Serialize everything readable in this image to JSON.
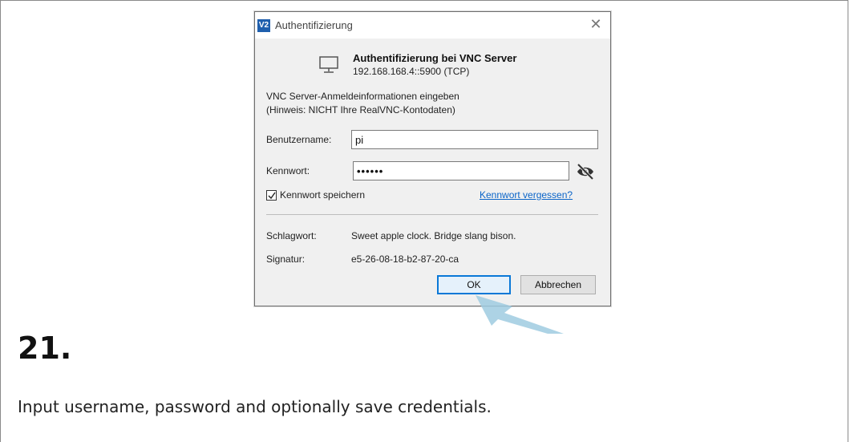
{
  "dialog": {
    "app_logo_text": "V2",
    "title": "Authentifizierung",
    "header_title": "Authentifizierung bei VNC Server",
    "header_subtitle": "192.168.168.4::5900 (TCP)",
    "hint_line1": "VNC Server-Anmeldeinformationen eingeben",
    "hint_line2": "(Hinweis: NICHT Ihre RealVNC-Kontodaten)",
    "username_label": "Benutzername:",
    "username_value": "pi",
    "password_label": "Kennwort:",
    "password_value": "••••••",
    "remember_label": "Kennwort speichern",
    "remember_checked": true,
    "forgot_link": "Kennwort vergessen?",
    "catchphrase_label": "Schlagwort:",
    "catchphrase_value": "Sweet apple clock. Bridge slang bison.",
    "signature_label": "Signatur:",
    "signature_value": "e5-26-08-18-b2-87-20-ca",
    "ok_label": "OK",
    "cancel_label": "Abbrechen"
  },
  "step": {
    "number": "21.",
    "description": "Input username, password and optionally save credentials."
  },
  "colors": {
    "logo": "#1f5fad",
    "link": "#0a64c8",
    "ok_border": "#0a78d7",
    "pointer": "#9fcbe0"
  }
}
